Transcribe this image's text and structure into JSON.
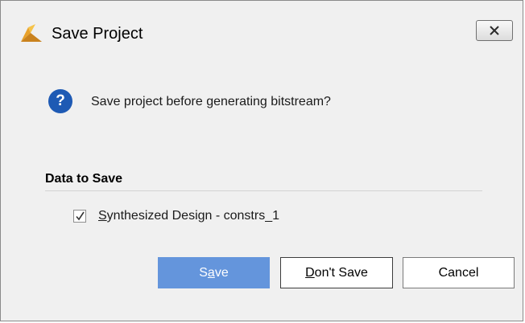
{
  "window": {
    "title": "Save Project",
    "app_icon": "vivado-logo-icon",
    "close_icon": "close-icon"
  },
  "dialog": {
    "icon": "question-icon",
    "question_glyph": "?",
    "message": "Save project before generating bitstream?",
    "section_title": "Data to Save",
    "items": [
      {
        "checked": true,
        "mnemonic": "S",
        "label_rest": "ynthesized Design - constrs_1"
      }
    ]
  },
  "buttons": {
    "save": {
      "pre": "S",
      "mnemonic": "a",
      "post": "ve"
    },
    "dont_save": {
      "pre": "",
      "mnemonic": "D",
      "post": "on't Save"
    },
    "cancel": {
      "label": "Cancel"
    }
  },
  "colors": {
    "accent": "#6495dc",
    "question_icon": "#1e5ab4",
    "background": "#f0f0f0"
  }
}
